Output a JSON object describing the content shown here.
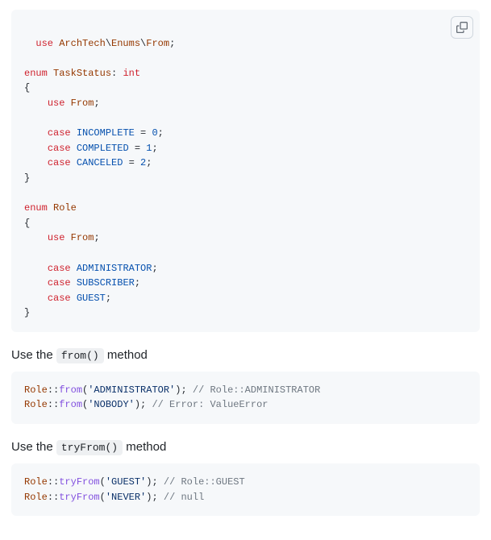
{
  "code1": {
    "tokens": [
      {
        "t": "use ",
        "c": "k"
      },
      {
        "t": "ArchTech",
        "c": "nc"
      },
      {
        "t": "\\",
        "c": "p"
      },
      {
        "t": "Enums",
        "c": "nc"
      },
      {
        "t": "\\",
        "c": "p"
      },
      {
        "t": "From",
        "c": "nc"
      },
      {
        "t": ";",
        "c": "p"
      },
      {
        "t": "\n\n",
        "c": "pl"
      },
      {
        "t": "enum ",
        "c": "k"
      },
      {
        "t": "TaskStatus",
        "c": "nc"
      },
      {
        "t": ": ",
        "c": "p"
      },
      {
        "t": "int",
        "c": "k"
      },
      {
        "t": "\n",
        "c": "pl"
      },
      {
        "t": "{",
        "c": "p"
      },
      {
        "t": "\n",
        "c": "pl"
      },
      {
        "t": "    ",
        "c": "pl"
      },
      {
        "t": "use ",
        "c": "k"
      },
      {
        "t": "From",
        "c": "nc"
      },
      {
        "t": ";",
        "c": "p"
      },
      {
        "t": "\n\n",
        "c": "pl"
      },
      {
        "t": "    ",
        "c": "pl"
      },
      {
        "t": "case ",
        "c": "k"
      },
      {
        "t": "INCOMPLETE",
        "c": "na"
      },
      {
        "t": " = ",
        "c": "p"
      },
      {
        "t": "0",
        "c": "m"
      },
      {
        "t": ";",
        "c": "p"
      },
      {
        "t": "\n",
        "c": "pl"
      },
      {
        "t": "    ",
        "c": "pl"
      },
      {
        "t": "case ",
        "c": "k"
      },
      {
        "t": "COMPLETED",
        "c": "na"
      },
      {
        "t": " = ",
        "c": "p"
      },
      {
        "t": "1",
        "c": "m"
      },
      {
        "t": ";",
        "c": "p"
      },
      {
        "t": "\n",
        "c": "pl"
      },
      {
        "t": "    ",
        "c": "pl"
      },
      {
        "t": "case ",
        "c": "k"
      },
      {
        "t": "CANCELED",
        "c": "na"
      },
      {
        "t": " = ",
        "c": "p"
      },
      {
        "t": "2",
        "c": "m"
      },
      {
        "t": ";",
        "c": "p"
      },
      {
        "t": "\n",
        "c": "pl"
      },
      {
        "t": "}",
        "c": "p"
      },
      {
        "t": "\n\n",
        "c": "pl"
      },
      {
        "t": "enum ",
        "c": "k"
      },
      {
        "t": "Role",
        "c": "nc"
      },
      {
        "t": "\n",
        "c": "pl"
      },
      {
        "t": "{",
        "c": "p"
      },
      {
        "t": "\n",
        "c": "pl"
      },
      {
        "t": "    ",
        "c": "pl"
      },
      {
        "t": "use ",
        "c": "k"
      },
      {
        "t": "From",
        "c": "nc"
      },
      {
        "t": ";",
        "c": "p"
      },
      {
        "t": "\n\n",
        "c": "pl"
      },
      {
        "t": "    ",
        "c": "pl"
      },
      {
        "t": "case ",
        "c": "k"
      },
      {
        "t": "ADMINISTRATOR",
        "c": "na"
      },
      {
        "t": ";",
        "c": "p"
      },
      {
        "t": "\n",
        "c": "pl"
      },
      {
        "t": "    ",
        "c": "pl"
      },
      {
        "t": "case ",
        "c": "k"
      },
      {
        "t": "SUBSCRIBER",
        "c": "na"
      },
      {
        "t": ";",
        "c": "p"
      },
      {
        "t": "\n",
        "c": "pl"
      },
      {
        "t": "    ",
        "c": "pl"
      },
      {
        "t": "case ",
        "c": "k"
      },
      {
        "t": "GUEST",
        "c": "na"
      },
      {
        "t": ";",
        "c": "p"
      },
      {
        "t": "\n",
        "c": "pl"
      },
      {
        "t": "}",
        "c": "p"
      }
    ]
  },
  "heading1": {
    "prefix": "Use the ",
    "code": "from()",
    "suffix": " method"
  },
  "code2": {
    "tokens": [
      {
        "t": "Role",
        "c": "nc"
      },
      {
        "t": "::",
        "c": "p"
      },
      {
        "t": "from",
        "c": "fn"
      },
      {
        "t": "(",
        "c": "p"
      },
      {
        "t": "'ADMINISTRATOR'",
        "c": "s"
      },
      {
        "t": ");",
        "c": "p"
      },
      {
        "t": " ",
        "c": "pl"
      },
      {
        "t": "// Role::ADMINISTRATOR",
        "c": "c"
      },
      {
        "t": "\n",
        "c": "pl"
      },
      {
        "t": "Role",
        "c": "nc"
      },
      {
        "t": "::",
        "c": "p"
      },
      {
        "t": "from",
        "c": "fn"
      },
      {
        "t": "(",
        "c": "p"
      },
      {
        "t": "'NOBODY'",
        "c": "s"
      },
      {
        "t": ");",
        "c": "p"
      },
      {
        "t": " ",
        "c": "pl"
      },
      {
        "t": "// Error: ValueError",
        "c": "c"
      }
    ]
  },
  "heading2": {
    "prefix": "Use the ",
    "code": "tryFrom()",
    "suffix": " method"
  },
  "code3": {
    "tokens": [
      {
        "t": "Role",
        "c": "nc"
      },
      {
        "t": "::",
        "c": "p"
      },
      {
        "t": "tryFrom",
        "c": "fn"
      },
      {
        "t": "(",
        "c": "p"
      },
      {
        "t": "'GUEST'",
        "c": "s"
      },
      {
        "t": ");",
        "c": "p"
      },
      {
        "t": " ",
        "c": "pl"
      },
      {
        "t": "// Role::GUEST",
        "c": "c"
      },
      {
        "t": "\n",
        "c": "pl"
      },
      {
        "t": "Role",
        "c": "nc"
      },
      {
        "t": "::",
        "c": "p"
      },
      {
        "t": "tryFrom",
        "c": "fn"
      },
      {
        "t": "(",
        "c": "p"
      },
      {
        "t": "'NEVER'",
        "c": "s"
      },
      {
        "t": ");",
        "c": "p"
      },
      {
        "t": " ",
        "c": "pl"
      },
      {
        "t": "// null",
        "c": "c"
      }
    ]
  }
}
